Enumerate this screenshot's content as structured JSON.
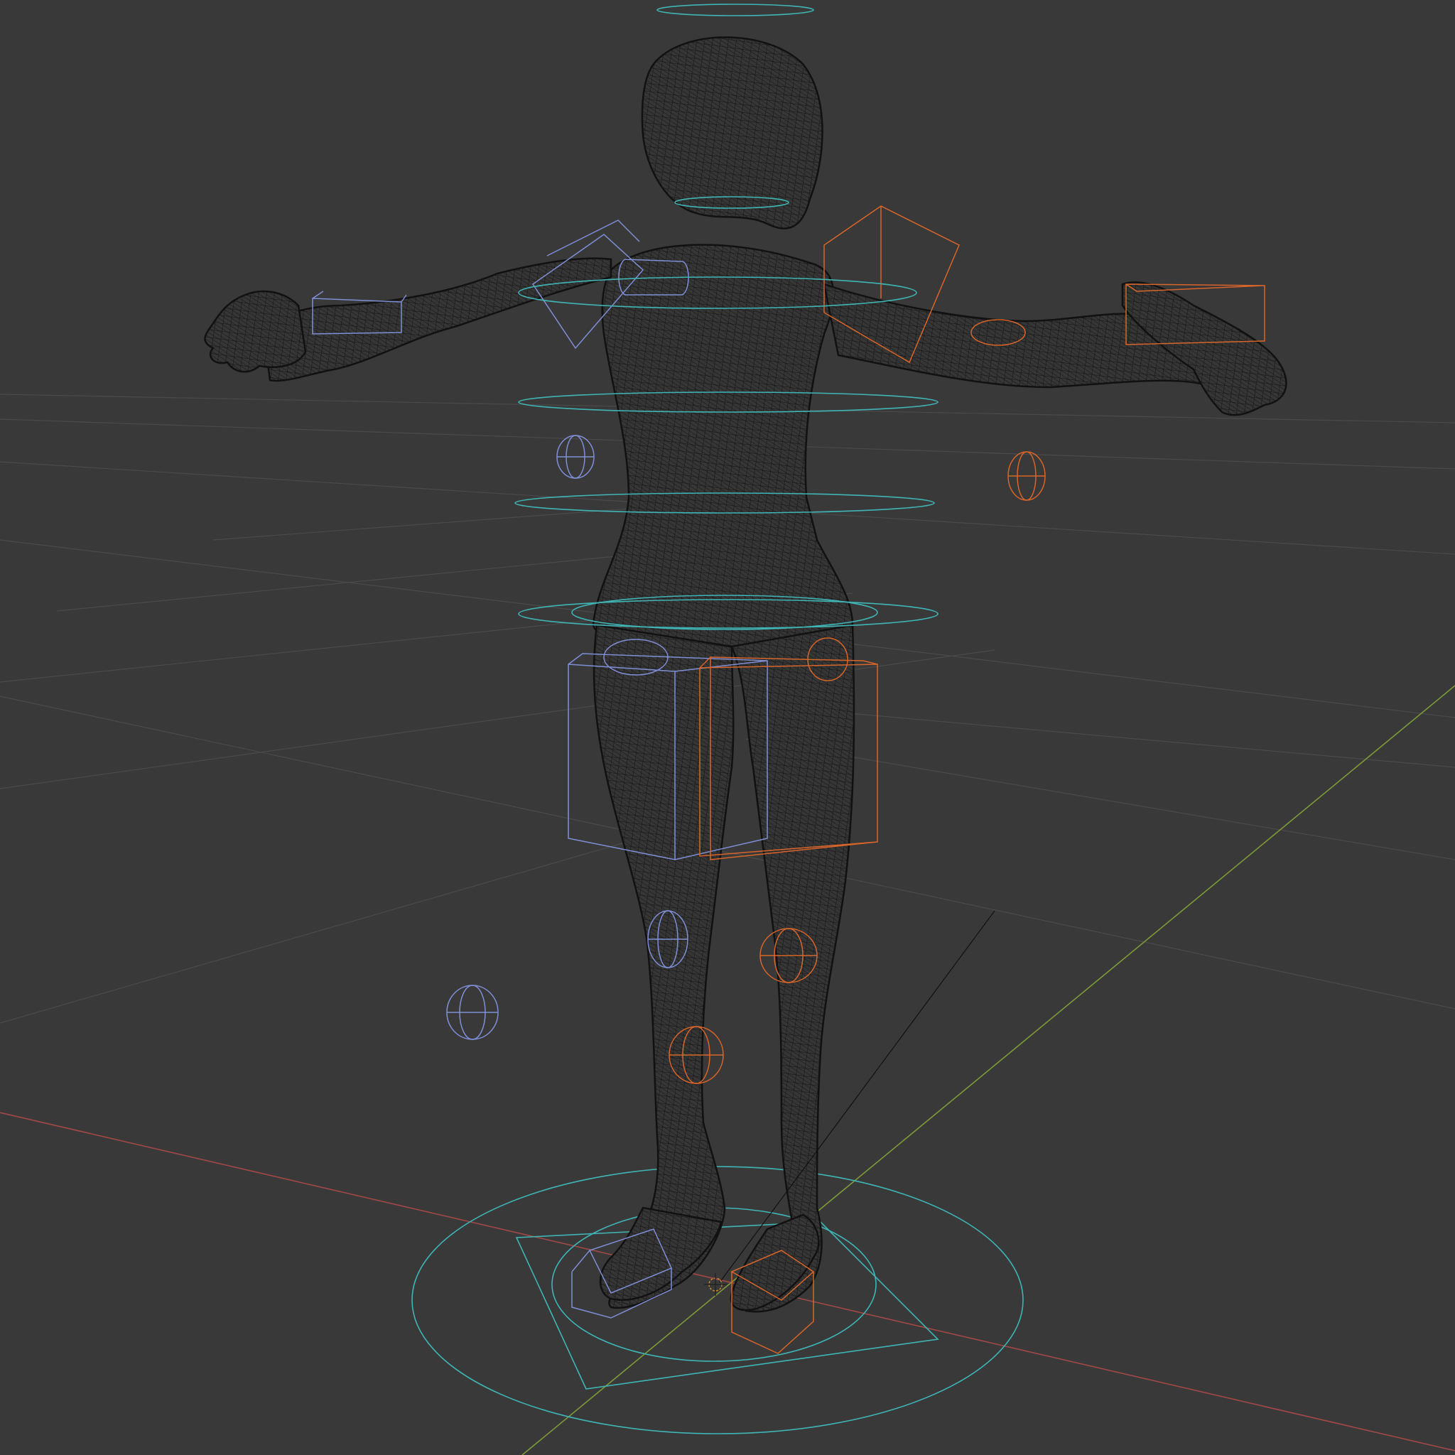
{
  "viewport": {
    "mode": "wireframe",
    "background_color": "#393939",
    "grid_color": "#4a4a4a",
    "x_axis_color": "#a34848",
    "y_axis_color": "#7e9a38"
  },
  "model": {
    "type": "humanoid-mesh",
    "pose": "t-pose",
    "wire_color": "#141414"
  },
  "rig": {
    "left_controls_color": "#7f8fd6",
    "right_controls_color": "#d8652a",
    "center_controls_color": "#3fb5b5"
  },
  "icons": {
    "origin": "3d-cursor-icon"
  }
}
